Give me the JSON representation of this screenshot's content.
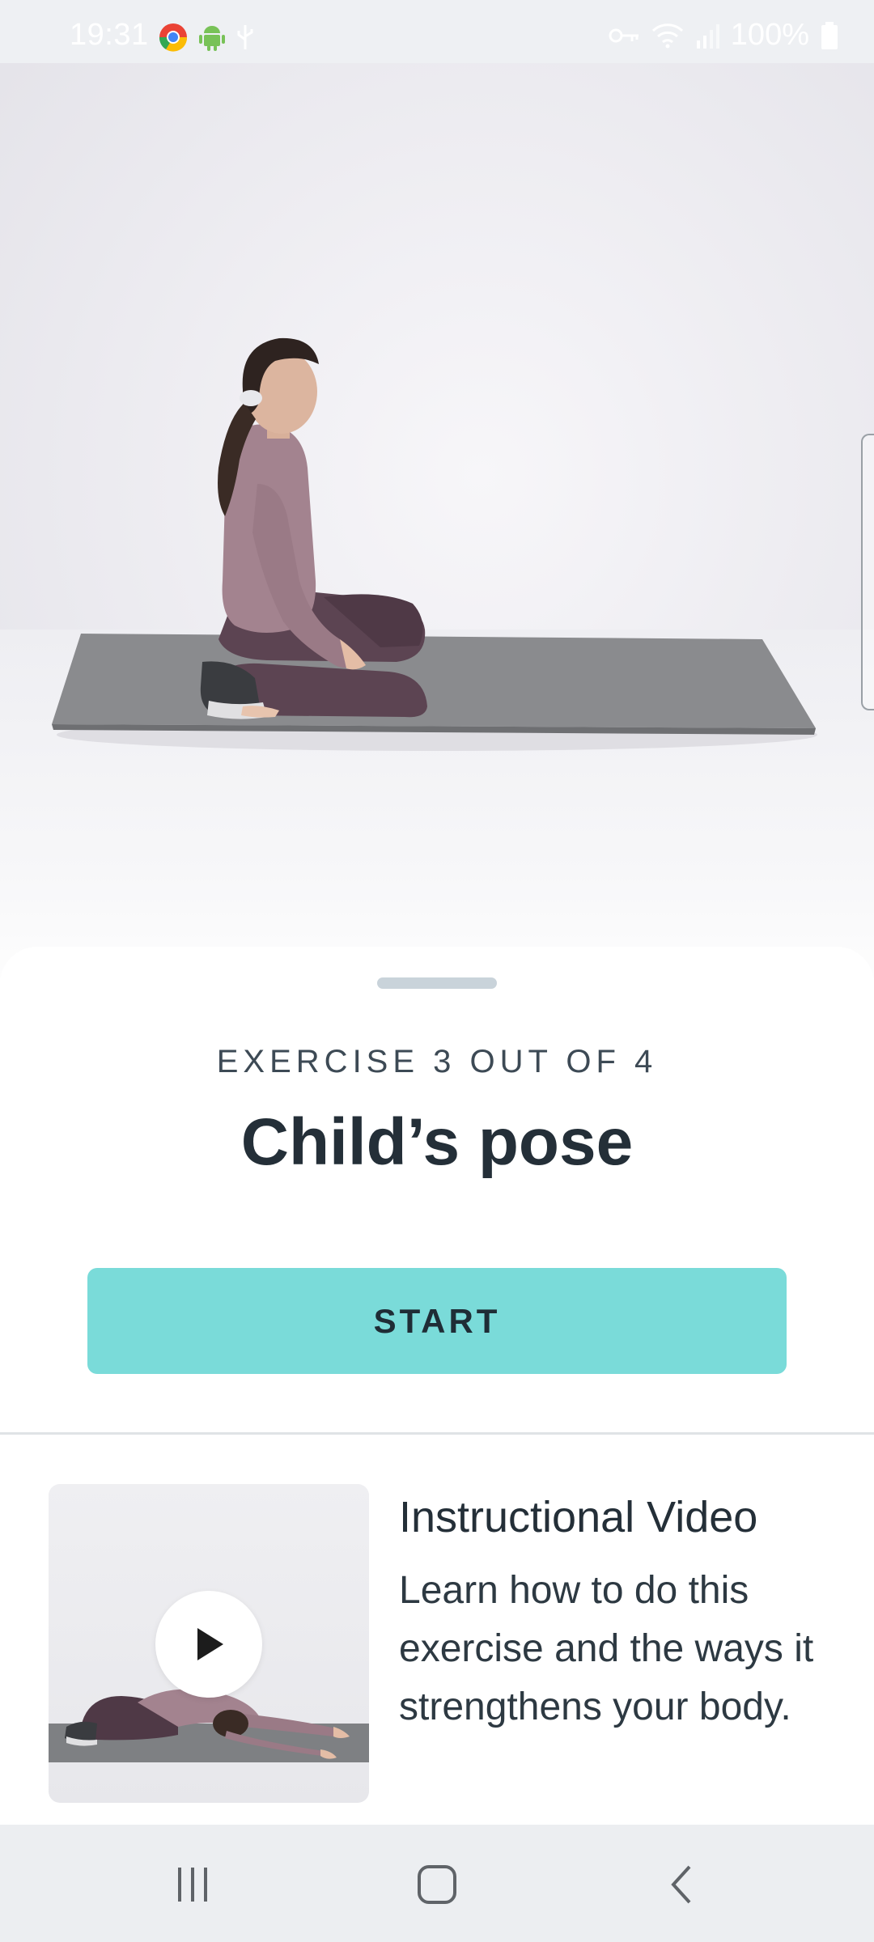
{
  "status_bar": {
    "time": "19:31",
    "battery": "100%",
    "icons_left": [
      "chrome-icon",
      "android-icon",
      "usb-icon"
    ],
    "icons_right": [
      "vpn-key-icon",
      "wifi-icon",
      "signal-icon",
      "battery-icon"
    ]
  },
  "hero": {
    "image": "woman kneeling on grey yoga mat"
  },
  "exercise": {
    "progress_label": "EXERCISE 3 OUT OF 4",
    "title": "Child’s pose",
    "start_label": "START"
  },
  "video_card": {
    "title": "Instructional Video",
    "description": "Learn how to do this exercise and the ways it strengthens your body."
  },
  "colors": {
    "accent": "#7adbd9",
    "text_dark": "#242f38",
    "mat": "#7e8083",
    "top_purple": "#a3838f",
    "leggings": "#5c4452"
  },
  "nav": {
    "recents": "recents-icon",
    "home": "home-icon",
    "back": "back-icon"
  }
}
